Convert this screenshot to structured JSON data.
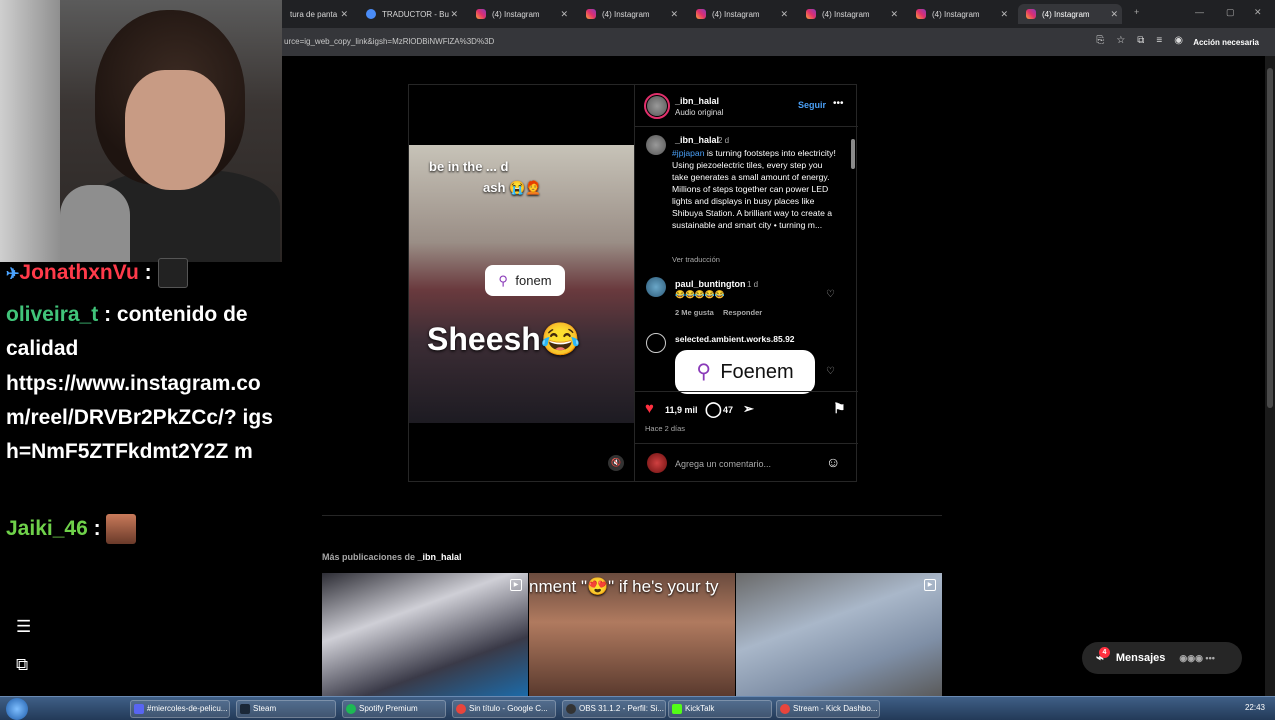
{
  "browser": {
    "tabs": [
      {
        "title": "tura de panta"
      },
      {
        "title": "TRADUCTOR - Bu"
      },
      {
        "title": "(4) Instagram"
      },
      {
        "title": "(4) Instagram"
      },
      {
        "title": "(4) Instagram"
      },
      {
        "title": "(4) Instagram"
      },
      {
        "title": "(4) Instagram"
      },
      {
        "title": "(4) Instagram"
      }
    ],
    "url": "urce=ig_web_copy_link&igsh=MzRlODBiNWFlZA%3D%3D",
    "action_button": "Acción necesaria"
  },
  "chat": {
    "messages": [
      {
        "user": "JonathxnVu",
        "sep": ":"
      },
      {
        "user": "oliveira_t",
        "sep": ":",
        "text": "contenido de calidad"
      },
      {
        "text": "https://www.instagram.co m/reel/DRVBr2PkZCc/? igsh=NmF5ZTFkdmt2Y2Z m"
      },
      {
        "user": "Jaiki_46",
        "sep": ":"
      }
    ],
    "icons": [
      "menu-icon",
      "sitemap-icon"
    ]
  },
  "post": {
    "author": "_ibn_halal",
    "audio": "Audio original",
    "follow": "Seguir",
    "video": {
      "caption_line1": "be in the ... d",
      "caption_line2": "ash 😭🧑‍🦰",
      "location_pill": "fonem",
      "overlay_text": "Sheesh😂"
    },
    "caption": {
      "author": "_ibn_halal",
      "age": "2 d",
      "hashtag": "#jpjapan",
      "text": " is turning footsteps into electricity! Using piezoelectric tiles, every step you take generates a small amount of energy. Millions of steps together can power LED lights and displays in busy places like Shibuya Station. A brilliant way to create a sustainable and smart city • turning m...",
      "translate": "Ver traducción"
    },
    "comments": [
      {
        "user": "paul_buntington",
        "age": "1 d",
        "text": "😂😂😂😂😂",
        "likes": "2 Me gusta",
        "reply": "Responder"
      },
      {
        "user": "selected.ambient.works.85.92",
        "location_pill": "Foenem"
      }
    ],
    "likes": "11,9 mil",
    "comments_count": "47",
    "time": "Hace 2 días",
    "comment_placeholder": "Agrega un comentario..."
  },
  "more": {
    "label": "Más publicaciones de",
    "author": "_ibn_halal",
    "thumbs": [
      {
        "text": ""
      },
      {
        "text": "nment \"😍\" if he's your ty"
      },
      {
        "text": ""
      }
    ]
  },
  "messages_button": "Mensajes",
  "messages_badge": "4",
  "taskbar": {
    "items": [
      "#miercoles-de-pelicu...",
      "Steam",
      "Spotify Premium",
      "Sin título - Google C...",
      "OBS 31.1.2 - Perfil: Si...",
      "KickTalk",
      "Stream - Kick Dashbo..."
    ],
    "clock": "22:43"
  }
}
